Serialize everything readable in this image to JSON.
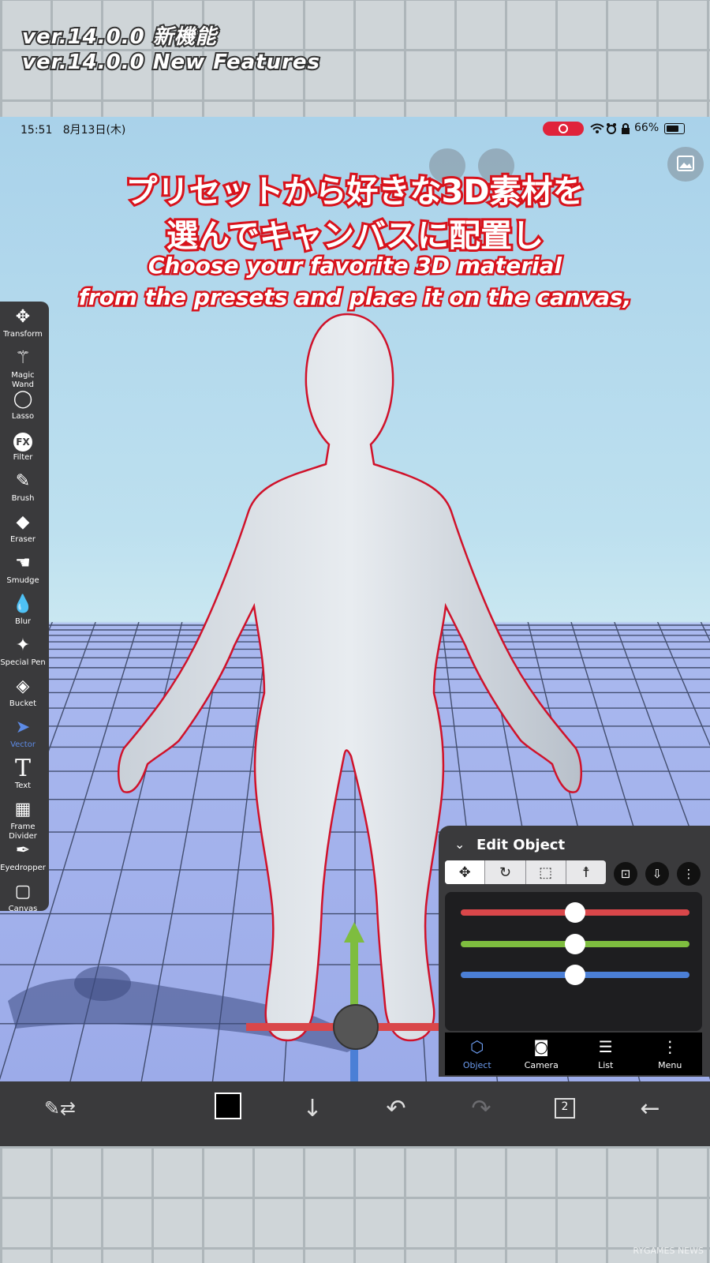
{
  "header": {
    "line_jp": "ver.14.0.0 新機能",
    "line_en": "ver.14.0.0 New Features"
  },
  "status_bar": {
    "time": "15:51",
    "date": "8月13日(木)",
    "battery": "66%"
  },
  "caption": {
    "jp_line1": "プリセットから好きな3D素材を",
    "jp_line2": "選んでキャンバスに配置し",
    "en_line1": "Choose your favorite 3D material",
    "en_line2": "from the presets and place it on the canvas,"
  },
  "toolbar": {
    "tools": [
      {
        "label": "Transform",
        "icon": "move-arrows-icon"
      },
      {
        "label": "Magic Wand",
        "icon": "magic-wand-icon"
      },
      {
        "label": "Lasso",
        "icon": "lasso-icon"
      },
      {
        "label": "Filter",
        "icon": "fx-icon"
      },
      {
        "label": "Brush",
        "icon": "brush-icon"
      },
      {
        "label": "Eraser",
        "icon": "eraser-icon"
      },
      {
        "label": "Smudge",
        "icon": "smudge-icon"
      },
      {
        "label": "Blur",
        "icon": "drop-icon"
      },
      {
        "label": "Special Pen",
        "icon": "sparkle-pen-icon"
      },
      {
        "label": "Bucket",
        "icon": "bucket-icon"
      },
      {
        "label": "Vector",
        "icon": "vector-cursor-icon"
      },
      {
        "label": "Text",
        "icon": "text-icon"
      },
      {
        "label": "Frame Divider",
        "icon": "frame-divider-icon"
      },
      {
        "label": "Eyedropper",
        "icon": "eyedropper-icon"
      },
      {
        "label": "Canvas",
        "icon": "canvas-icon"
      }
    ],
    "active": "Vector"
  },
  "edit_panel": {
    "title": "Edit Object",
    "sliders": [
      {
        "color": "#d9474a",
        "value": 0.5
      },
      {
        "color": "#7ebd3f",
        "value": 0.5
      },
      {
        "color": "#4b7fd6",
        "value": 0.5
      }
    ],
    "tabs": [
      {
        "label": "Object",
        "icon": "cube-icon"
      },
      {
        "label": "Camera",
        "icon": "camera-icon"
      },
      {
        "label": "List",
        "icon": "list-icon"
      },
      {
        "label": "Menu",
        "icon": "more-vertical-icon"
      }
    ],
    "active_tab": "Object"
  },
  "bottom_bar": {
    "page_count": "2"
  },
  "watermark": "RYGAMES NEWS",
  "colors": {
    "accent": "#5d8be6",
    "caption_stroke": "#d8121b",
    "toolbar_bg": "#3a3a3c"
  }
}
